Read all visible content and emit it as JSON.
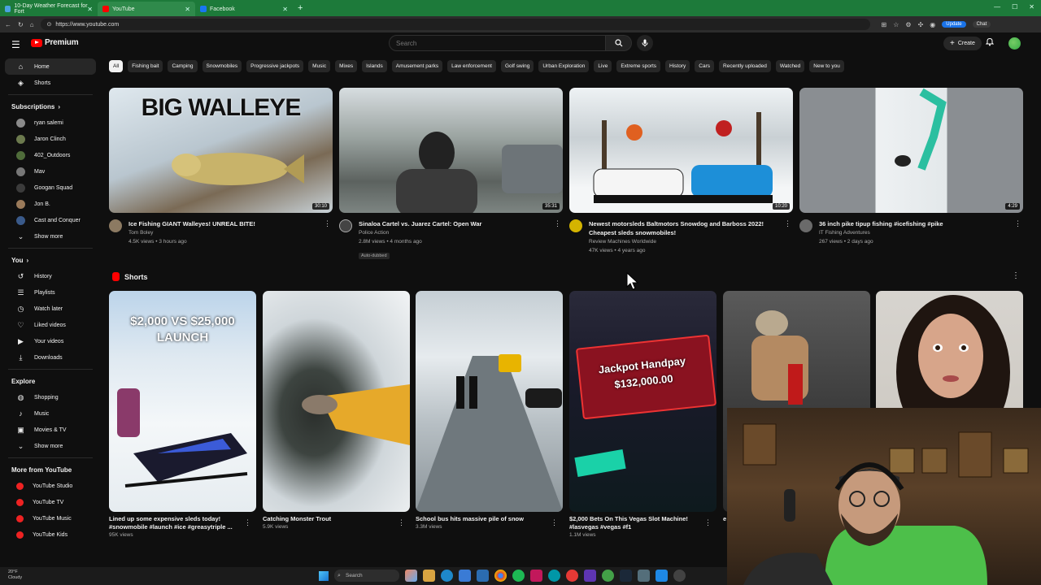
{
  "browser": {
    "tabs": [
      {
        "label": "10-Day Weather Forecast for Fort",
        "color": "#4aa3df"
      },
      {
        "label": "YouTube",
        "color": "#ff0000"
      },
      {
        "label": "Facebook",
        "color": "#1877f2"
      }
    ],
    "url": "https://www.youtube.com",
    "update_label": "Update",
    "chat_label": "Chat"
  },
  "header": {
    "logo_text": "Premium",
    "search_placeholder": "Search",
    "create_label": "Create"
  },
  "sidebar": {
    "main": [
      {
        "label": "Home",
        "icon": "⌂"
      },
      {
        "label": "Shorts",
        "icon": "◈"
      }
    ],
    "subscriptions_title": "Subscriptions",
    "subscriptions": [
      {
        "label": "ryan salemi",
        "color": "#8a8a8a"
      },
      {
        "label": "Jaron Clinch",
        "color": "#6c7a4e"
      },
      {
        "label": "402_Outdoors",
        "color": "#4f6c3a"
      },
      {
        "label": "Mav",
        "color": "#777777"
      },
      {
        "label": "Googan Squad",
        "color": "#3b3b3b"
      },
      {
        "label": "Jon B.",
        "color": "#9a7a5a"
      },
      {
        "label": "Cast and Conquer",
        "color": "#3a5a8a"
      }
    ],
    "show_more": "Show more",
    "you_title": "You",
    "you": [
      {
        "label": "History",
        "icon": "↺"
      },
      {
        "label": "Playlists",
        "icon": "☰"
      },
      {
        "label": "Watch later",
        "icon": "◷"
      },
      {
        "label": "Liked videos",
        "icon": "♡"
      },
      {
        "label": "Your videos",
        "icon": "▶"
      },
      {
        "label": "Downloads",
        "icon": "⤓"
      }
    ],
    "explore_title": "Explore",
    "explore": [
      {
        "label": "Shopping",
        "icon": "◍"
      },
      {
        "label": "Music",
        "icon": "♪"
      },
      {
        "label": "Movies & TV",
        "icon": "▣"
      }
    ],
    "explore_show_more": "Show more",
    "more_title": "More from YouTube",
    "more": [
      {
        "label": "YouTube Studio"
      },
      {
        "label": "YouTube TV"
      },
      {
        "label": "YouTube Music"
      },
      {
        "label": "YouTube Kids"
      }
    ]
  },
  "chips": [
    "All",
    "Fishing bait",
    "Camping",
    "Snowmobiles",
    "Progressive jackpots",
    "Music",
    "Mixes",
    "Islands",
    "Amusement parks",
    "Law enforcement",
    "Golf swing",
    "Urban Exploration",
    "Live",
    "Extreme sports",
    "History",
    "Cars",
    "Recently uploaded",
    "Watched",
    "New to you"
  ],
  "videos": [
    {
      "title": "Ice Fishing GIANT Walleyes! UNREAL BITE!",
      "channel": "Tom Boley",
      "meta": "4.5K views • 3 hours ago",
      "duration": "30:10",
      "thumb_text": "BIG WALLEYE",
      "badge": ""
    },
    {
      "title": "Sinaloa Cartel vs. Juarez Cartel: Open War",
      "channel": "Police Action",
      "meta": "2.8M views • 4 months ago",
      "duration": "35:31",
      "thumb_text": "",
      "badge": "Auto-dubbed"
    },
    {
      "title": "Newest motorsleds Baltmotors Snowdog and Barboss 2022! Cheapest sleds snowmobiles!",
      "channel": "Review Machines Worldwide",
      "meta": "47K views • 4 years ago",
      "duration": "10:20",
      "thumb_text": "",
      "badge": ""
    },
    {
      "title": "36 inch pike tipup fishing #icefishing #pike",
      "channel": "IT Fishing Adventures",
      "meta": "267 views • 2 days ago",
      "duration": "4:29",
      "thumb_text": "",
      "badge": ""
    }
  ],
  "shorts_title": "Shorts",
  "shorts": [
    {
      "title": "Lined up some expensive sleds today! #snowmobile #launch #ice #greasytriple ...",
      "views": "95K views",
      "thumb_text": "$2,000 VS $25,000 LAUNCH"
    },
    {
      "title": "Catching Monster Trout",
      "views": "5.9K views",
      "thumb_text": ""
    },
    {
      "title": "School bus hits massive pile of snow",
      "views": "3.3M views",
      "thumb_text": ""
    },
    {
      "title": "$2,000 Bets On This Vegas Slot Machine! #lasvegas #vegas #f1",
      "views": "1.1M views",
      "thumb_text": "Jackpot Handpay $132,000.00"
    },
    {
      "title": "e",
      "views": "",
      "thumb_text": ""
    },
    {
      "title": "",
      "views": "",
      "thumb_text": ""
    }
  ],
  "taskbar": {
    "weather_temp": "20°F",
    "weather_desc": "Cloudy",
    "search_label": "Search"
  }
}
